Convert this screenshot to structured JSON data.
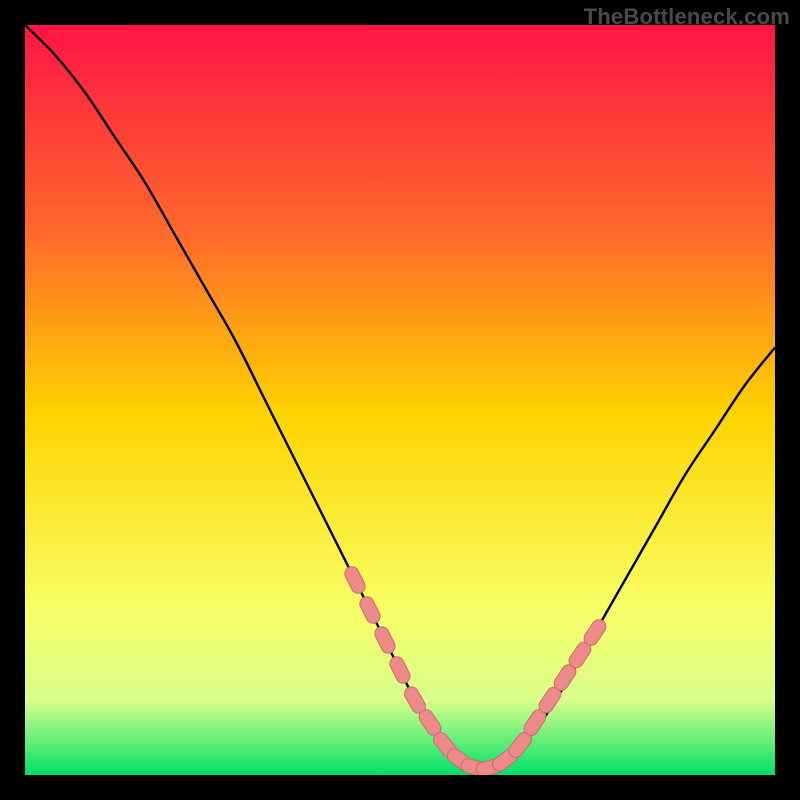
{
  "watermark": "TheBottleneck.com",
  "colors": {
    "gradient_top": "#ff1446",
    "gradient_mid_upper": "#ff6a2a",
    "gradient_mid": "#ffd400",
    "gradient_mid_lower": "#f7ff66",
    "gradient_lower": "#d8ff8a",
    "gradient_bottom": "#00e06a",
    "curve": "#000000",
    "marker_fill": "#ef8a8b",
    "marker_stroke": "#c76c6e"
  },
  "chart_data": {
    "type": "line",
    "title": "",
    "xlabel": "",
    "ylabel": "",
    "xlim": [
      0,
      100
    ],
    "ylim": [
      0,
      100
    ],
    "grid": false,
    "legend": false,
    "series": [
      {
        "name": "bottleneck-curve",
        "x": [
          0,
          4,
          8,
          12,
          16,
          20,
          24,
          28,
          32,
          36,
          40,
          44,
          48,
          52,
          55,
          58,
          61,
          64,
          68,
          72,
          76,
          80,
          84,
          88,
          92,
          96,
          100
        ],
        "y": [
          100,
          96,
          91,
          85,
          79,
          72,
          65,
          58,
          50,
          42,
          34,
          26,
          18,
          10,
          5,
          2,
          1,
          2,
          6,
          12,
          19,
          26,
          33,
          40,
          46,
          52,
          57
        ]
      }
    ],
    "markers": {
      "name": "highlight-dots",
      "x": [
        44,
        46,
        48,
        50,
        52,
        54,
        56,
        58,
        60,
        62,
        64,
        66,
        68,
        70,
        72,
        74,
        76
      ],
      "y": [
        26,
        22,
        18,
        14,
        10,
        7,
        4,
        2,
        1,
        1,
        2,
        4,
        7,
        10,
        13,
        16,
        19
      ]
    }
  }
}
